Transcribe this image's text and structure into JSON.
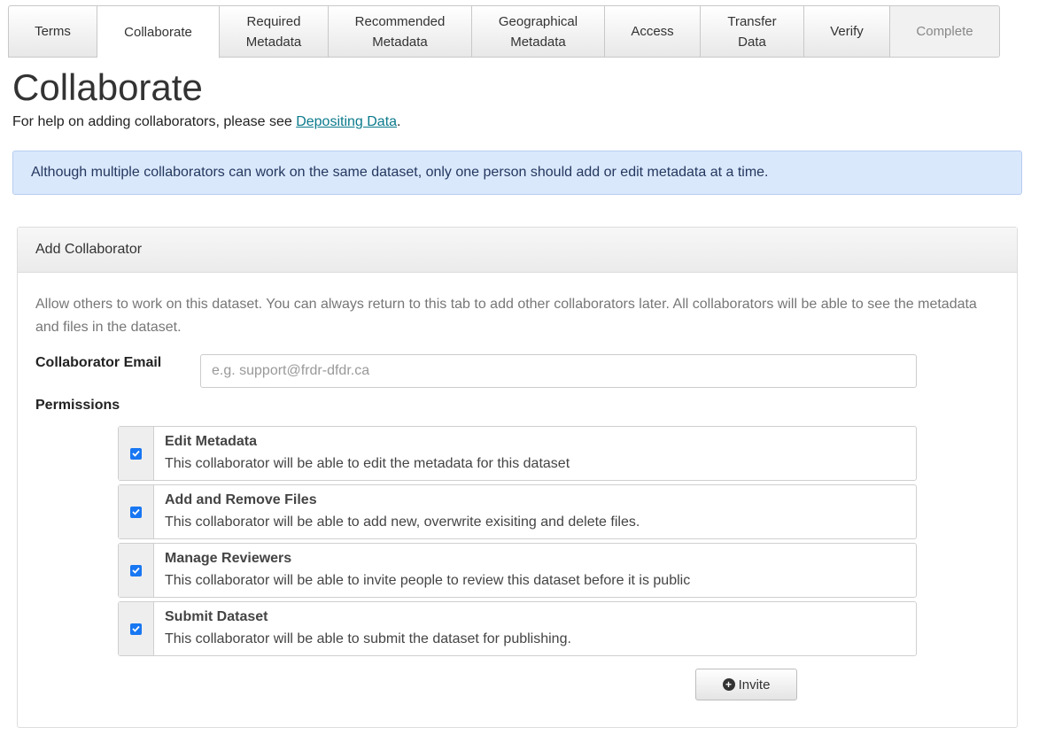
{
  "tabs": [
    {
      "label": "Terms",
      "state": "normal"
    },
    {
      "label": "Collaborate",
      "state": "active"
    },
    {
      "label": "Required\nMetadata",
      "state": "normal"
    },
    {
      "label": "Recommended\nMetadata",
      "state": "normal"
    },
    {
      "label": "Geographical\nMetadata",
      "state": "normal"
    },
    {
      "label": "Access",
      "state": "normal"
    },
    {
      "label": "Transfer\nData",
      "state": "normal"
    },
    {
      "label": "Verify",
      "state": "normal"
    },
    {
      "label": "Complete",
      "state": "disabled"
    }
  ],
  "page": {
    "title": "Collaborate",
    "help_prefix": "For help on adding collaborators, please see ",
    "help_link": "Depositing Data",
    "help_suffix": "."
  },
  "alert": {
    "text": "Although multiple collaborators can work on the same dataset, only one person should add or edit metadata at a time."
  },
  "panel": {
    "heading": "Add Collaborator",
    "description": "Allow others to work on this dataset. You can always return to this tab to add other collaborators later. All collaborators will be able to see the metadata and files in the dataset.",
    "email_label": "Collaborator Email",
    "email_value": "",
    "email_placeholder": "e.g. support@frdr-dfdr.ca",
    "permissions_label": "Permissions",
    "permissions": [
      {
        "title": "Edit Metadata",
        "desc": "This collaborator will be able to edit the metadata for this dataset",
        "checked": true
      },
      {
        "title": "Add and Remove Files",
        "desc": "This collaborator will be able to add new, overwrite exisiting and delete files.",
        "checked": true
      },
      {
        "title": "Manage Reviewers",
        "desc": "This collaborator will be able to invite people to review this dataset before it is public",
        "checked": true
      },
      {
        "title": "Submit Dataset",
        "desc": "This collaborator will be able to submit the dataset for publishing.",
        "checked": true
      }
    ],
    "invite_label": "Invite",
    "invite_icon": "plus-circle-icon"
  },
  "colors": {
    "accent_check": "#1877f2",
    "link": "#0b7a8c",
    "alert_bg": "#dae8fc"
  }
}
